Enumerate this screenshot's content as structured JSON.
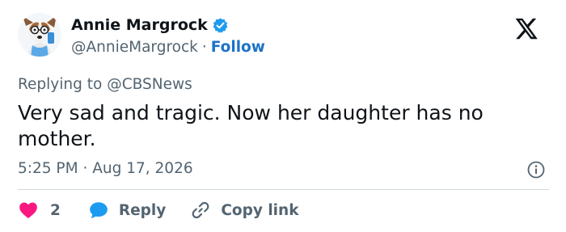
{
  "author": {
    "display_name": "Annie Margrock",
    "handle": "@AnnieMargrock",
    "separator": "·",
    "follow_label": "Follow",
    "verified": true
  },
  "reply_context": {
    "prefix": "Replying to",
    "mention": "@CBSNews"
  },
  "tweet": {
    "text": "Very sad and tragic. Now her daughter has no mother.",
    "time": "5:25 PM",
    "separator": "·",
    "date": "Aug 17, 2026"
  },
  "actions": {
    "like_count": "2",
    "reply_label": "Reply",
    "copy_link_label": "Copy link"
  },
  "icons": {
    "verified": "verified-badge-icon",
    "platform": "x-logo-icon",
    "info": "info-icon",
    "like": "heart-icon",
    "reply": "speech-bubble-icon",
    "copy_link": "link-icon"
  },
  "colors": {
    "text_primary": "#0f1419",
    "text_secondary": "#536471",
    "accent_blue": "#1d72c8",
    "verified_blue": "#1d9bf0",
    "like_pink": "#f91880",
    "divider": "#cfd9de"
  }
}
